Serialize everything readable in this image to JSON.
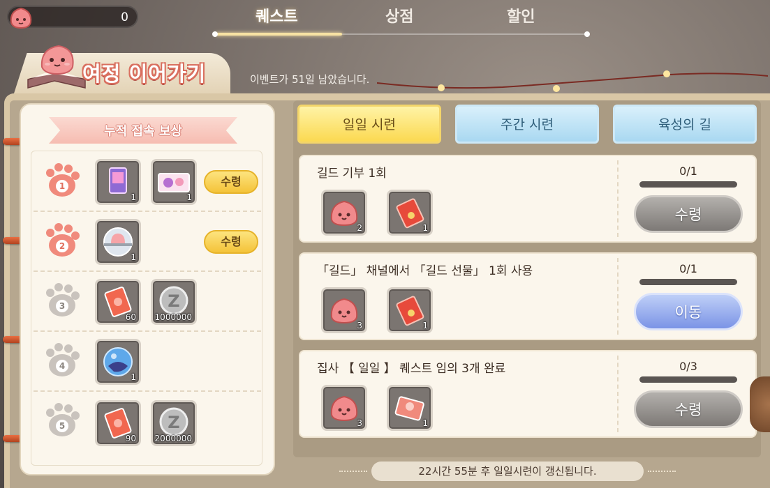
{
  "currency": {
    "icon": "pink-slime-icon",
    "value": "0"
  },
  "tabs": [
    {
      "label": "퀘스트",
      "active": true
    },
    {
      "label": "상점",
      "active": false
    },
    {
      "label": "할인",
      "active": false
    }
  ],
  "banner": {
    "title": "여정 이어가기",
    "notice": "이벤트가 51일 남았습니다."
  },
  "login_rewards": {
    "title": "누적 접속 보상",
    "claim_label": "수령",
    "rows": [
      {
        "day": "1",
        "items": [
          {
            "icon": "card-pack-icon",
            "qty": "1"
          },
          {
            "icon": "ticket-icon",
            "qty": "1"
          }
        ],
        "claimable": true
      },
      {
        "day": "2",
        "items": [
          {
            "icon": "capsule-icon",
            "qty": "1"
          }
        ],
        "claimable": true
      },
      {
        "day": "3",
        "items": [
          {
            "icon": "red-coupon-icon",
            "qty": "60"
          },
          {
            "icon": "zeny-coin-icon",
            "qty": "1000000"
          }
        ],
        "claimable": false
      },
      {
        "day": "4",
        "items": [
          {
            "icon": "crystal-orb-icon",
            "qty": "1"
          }
        ],
        "claimable": false
      },
      {
        "day": "5",
        "items": [
          {
            "icon": "red-coupon-icon",
            "qty": "90"
          },
          {
            "icon": "zeny-coin-icon",
            "qty": "2000000"
          }
        ],
        "claimable": false
      }
    ]
  },
  "quest_tabs": [
    {
      "label": "일일 시련",
      "active": true
    },
    {
      "label": "주간 시련",
      "active": false
    },
    {
      "label": "육성의 길",
      "active": false
    }
  ],
  "quests": [
    {
      "title": "길드 기부 1회",
      "progress": "0/1",
      "progress_fraction": 0,
      "action": "수령",
      "action_style": "grey",
      "items": [
        {
          "icon": "pink-slime-icon",
          "qty": "2"
        },
        {
          "icon": "red-envelope-icon",
          "qty": "1"
        }
      ]
    },
    {
      "title": "「길드」 채널에서 「길드 선물」 1회 사용",
      "progress": "0/1",
      "progress_fraction": 0,
      "action": "이동",
      "action_style": "blue",
      "items": [
        {
          "icon": "pink-slime-icon",
          "qty": "3"
        },
        {
          "icon": "red-envelope-icon",
          "qty": "1"
        }
      ]
    },
    {
      "title": "집사 【 일일 】 퀘스트 임의 3개 완료",
      "progress": "0/3",
      "progress_fraction": 0,
      "action": "수령",
      "action_style": "grey",
      "items": [
        {
          "icon": "pink-slime-icon",
          "qty": "3"
        },
        {
          "icon": "red-card-icon",
          "qty": "1"
        }
      ]
    }
  ],
  "footer": {
    "refresh_notice": "22시간 55분 후 일일시련이 갱신됩니다."
  },
  "colors": {
    "claim_yellow": "#f4c339",
    "move_blue": "#7b94e6",
    "paw_active": "#f08a7c",
    "paw_inactive": "#c9c3bd"
  }
}
